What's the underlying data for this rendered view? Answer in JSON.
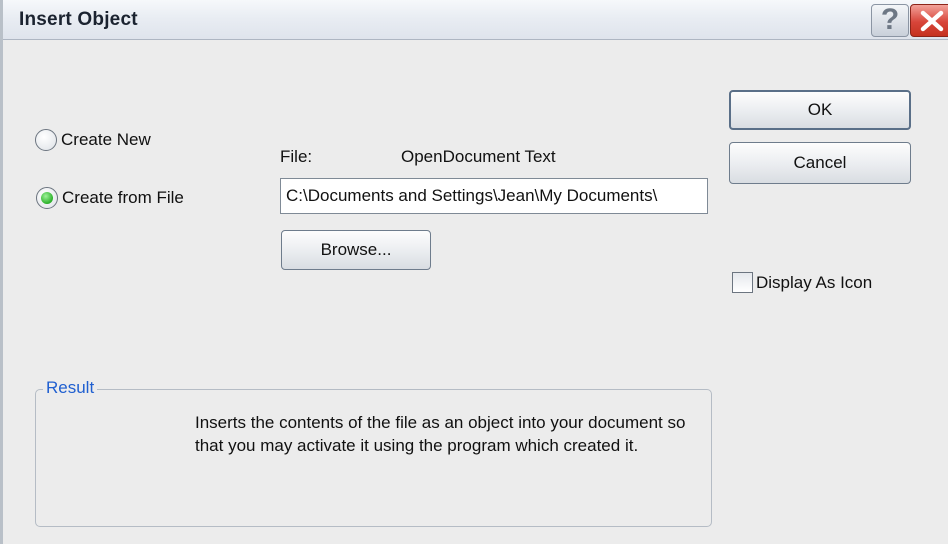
{
  "window": {
    "title": "Insert Object",
    "help_glyph": "?",
    "help_icon": "question-mark-icon",
    "close_icon": "close-x-icon"
  },
  "options": {
    "create_new_label": "Create New",
    "create_from_file_label": "Create from File",
    "selected": "Create from File"
  },
  "file": {
    "label": "File:",
    "type": "OpenDocument Text",
    "path": "C:\\Documents and Settings\\Jean\\My Documents\\",
    "browse_label": "Browse..."
  },
  "buttons": {
    "ok_label": "OK",
    "cancel_label": "Cancel"
  },
  "display_as_icon": {
    "label": "Display As Icon",
    "checked": false
  },
  "result": {
    "legend": "Result",
    "description": "Inserts the contents of the file as an object into your document so that you may activate it using the program which created it."
  },
  "colors": {
    "legend_blue": "#1f5fd0",
    "close_red": "#d8453a",
    "radio_green": "#2bb12a"
  }
}
